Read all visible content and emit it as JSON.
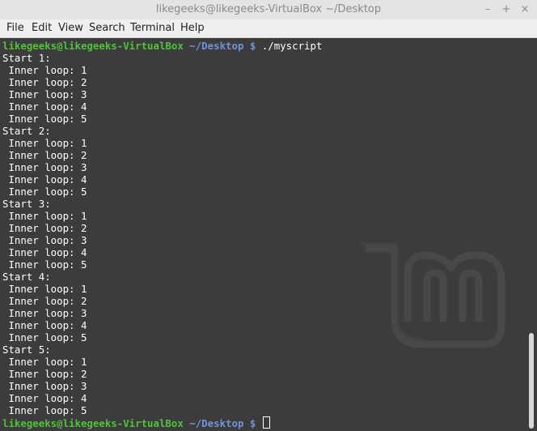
{
  "window": {
    "title": "likegeeks@likegeeks-VirtualBox ~/Desktop",
    "minimize_glyph": "–",
    "maximize_glyph": "+",
    "close_glyph": "×"
  },
  "menu": {
    "file": "File",
    "edit": "Edit",
    "view": "View",
    "search": "Search",
    "terminal": "Terminal",
    "help": "Help"
  },
  "terminal": {
    "prompt_user": "likegeeks@likegeeks-VirtualBox",
    "prompt_path": "~/Desktop",
    "prompt_symbol": "$",
    "command": "./myscript",
    "output": [
      "Start 1:",
      " Inner loop: 1",
      " Inner loop: 2",
      " Inner loop: 3",
      " Inner loop: 4",
      " Inner loop: 5",
      "Start 2:",
      " Inner loop: 1",
      " Inner loop: 2",
      " Inner loop: 3",
      " Inner loop: 4",
      " Inner loop: 5",
      "Start 3:",
      " Inner loop: 1",
      " Inner loop: 2",
      " Inner loop: 3",
      " Inner loop: 4",
      " Inner loop: 5",
      "Start 4:",
      " Inner loop: 1",
      " Inner loop: 2",
      " Inner loop: 3",
      " Inner loop: 4",
      " Inner loop: 5",
      "Start 5:",
      " Inner loop: 1",
      " Inner loop: 2",
      " Inner loop: 3",
      " Inner loop: 4",
      " Inner loop: 5"
    ],
    "watermark_icon": "linux-mint-logo-icon"
  },
  "colors": {
    "background": "#3c3c3c",
    "prompt_user": "#52c13a",
    "prompt_path": "#6f95d8",
    "text": "#ffffff"
  }
}
